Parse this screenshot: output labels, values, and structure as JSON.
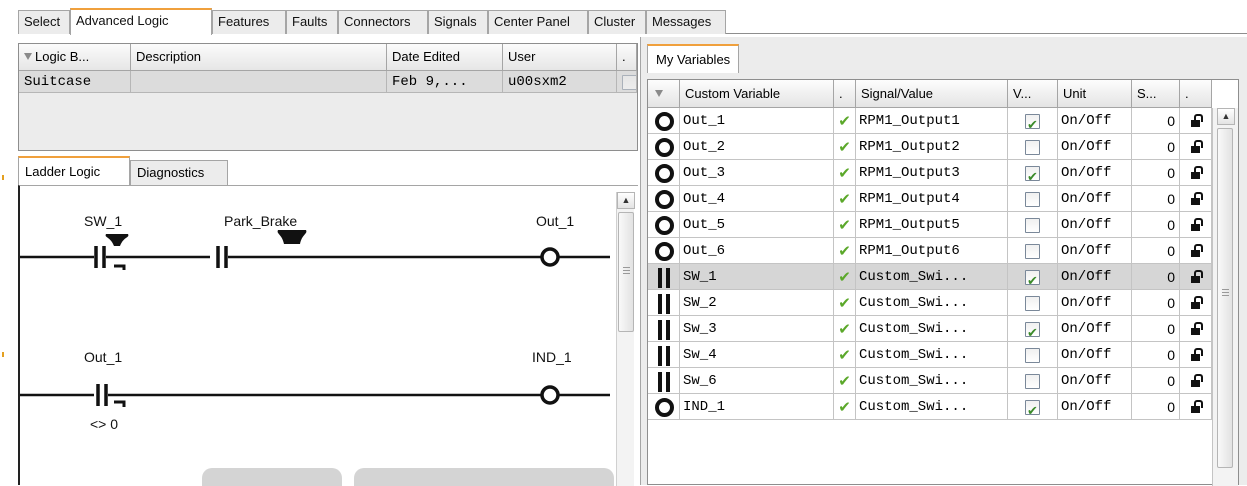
{
  "top_tabs": [
    "Select",
    "Advanced Logic",
    "Features",
    "Faults",
    "Connectors",
    "Signals",
    "Center Panel",
    "Cluster",
    "Messages"
  ],
  "logic_table": {
    "headers": [
      "Logic B...",
      "Description",
      "Date Edited",
      "User",
      "."
    ],
    "row": {
      "logic_block": "Suitcase",
      "description": "",
      "date": "Feb 9,...",
      "user": "u00sxm2"
    }
  },
  "inner_tabs": [
    "Ladder Logic",
    "Diagnostics"
  ],
  "ladder": {
    "rung1": {
      "contact1": "SW_1",
      "contact2": "Park_Brake",
      "coil": "Out_1"
    },
    "rung2": {
      "contact1": "Out_1",
      "contact1_condition": "<> 0",
      "coil": "IND_1"
    }
  },
  "right_tab": "My Variables",
  "vars": {
    "headers": [
      "Custom Variable",
      ".",
      "Signal/Value",
      "V...",
      "Unit",
      "S...",
      "."
    ],
    "rows": [
      {
        "type": "coil",
        "name": "Out_1",
        "signal": "RPM1_Output1",
        "v": true,
        "unit": "On/Off",
        "s": "0"
      },
      {
        "type": "coil",
        "name": "Out_2",
        "signal": "RPM1_Output2",
        "v": false,
        "unit": "On/Off",
        "s": "0"
      },
      {
        "type": "coil",
        "name": "Out_3",
        "signal": "RPM1_Output3",
        "v": true,
        "unit": "On/Off",
        "s": "0"
      },
      {
        "type": "coil",
        "name": "Out_4",
        "signal": "RPM1_Output4",
        "v": false,
        "unit": "On/Off",
        "s": "0"
      },
      {
        "type": "coil",
        "name": "Out_5",
        "signal": "RPM1_Output5",
        "v": false,
        "unit": "On/Off",
        "s": "0"
      },
      {
        "type": "coil",
        "name": "Out_6",
        "signal": "RPM1_Output6",
        "v": false,
        "unit": "On/Off",
        "s": "0"
      },
      {
        "type": "contact",
        "name": "SW_1",
        "signal": "Custom_Swi...",
        "v": true,
        "unit": "On/Off",
        "s": "0",
        "selected": true
      },
      {
        "type": "contact",
        "name": "SW_2",
        "signal": "Custom_Swi...",
        "v": false,
        "unit": "On/Off",
        "s": "0"
      },
      {
        "type": "contact",
        "name": "Sw_3",
        "signal": "Custom_Swi...",
        "v": true,
        "unit": "On/Off",
        "s": "0"
      },
      {
        "type": "contact",
        "name": "Sw_4",
        "signal": "Custom_Swi...",
        "v": false,
        "unit": "On/Off",
        "s": "0"
      },
      {
        "type": "contact",
        "name": "Sw_6",
        "signal": "Custom_Swi...",
        "v": false,
        "unit": "On/Off",
        "s": "0"
      },
      {
        "type": "coil",
        "name": "IND_1",
        "signal": "Custom_Swi...",
        "v": true,
        "unit": "On/Off",
        "s": "0"
      }
    ]
  },
  "colors": {
    "accent_tab": "#f0a03c",
    "check_green": "#5ba82a",
    "selected_row": "#d6d6d6"
  },
  "icons": {
    "coil": "coil-icon",
    "contact": "contact-icon",
    "lock": "lock-icon",
    "valid": "check-icon",
    "filter": "filter-icon"
  }
}
